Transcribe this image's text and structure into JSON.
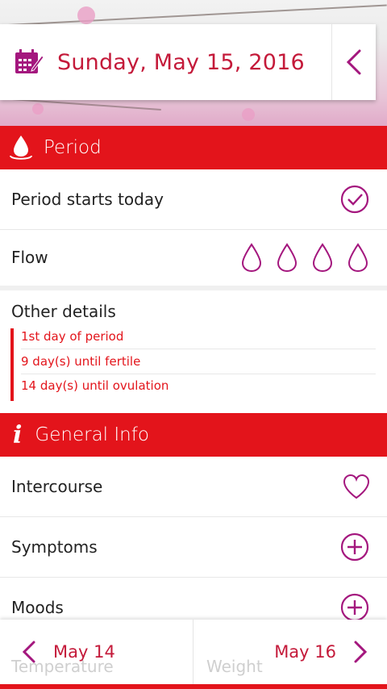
{
  "header": {
    "date": "Sunday, May 15, 2016"
  },
  "period_section": {
    "title": "Period",
    "rows": {
      "starts": {
        "label": "Period starts today"
      },
      "flow": {
        "label": "Flow",
        "drops": 4
      }
    }
  },
  "other_details": {
    "label": "Other details",
    "items": [
      "1st day of period",
      "9 day(s) until fertile",
      "14 day(s) until ovulation"
    ]
  },
  "general_section": {
    "title": "General Info",
    "rows": {
      "intercourse": {
        "label": "Intercourse"
      },
      "symptoms": {
        "label": "Symptoms"
      },
      "moods": {
        "label": "Moods"
      }
    }
  },
  "hidden_rows": {
    "temperature": "Temperature",
    "weight": "Weight"
  },
  "nav": {
    "prev": "May 14",
    "next": "May 16"
  },
  "colors": {
    "accent_red": "#e3141b",
    "title_red": "#c41a3a",
    "icon_magenta": "#a4177e"
  }
}
